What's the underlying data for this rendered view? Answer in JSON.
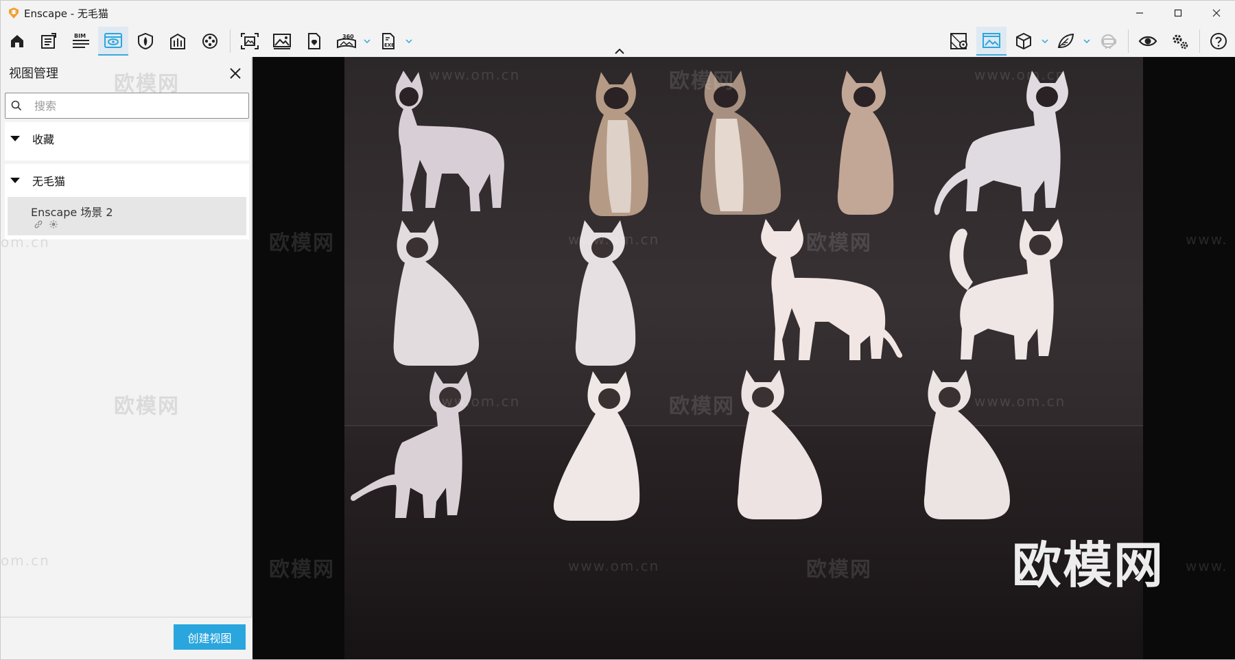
{
  "window": {
    "title": "Enscape - 无毛猫",
    "minimize_label": "minimize",
    "maximize_label": "maximize",
    "close_label": "close"
  },
  "toolbar": {
    "bim_label": "BIM",
    "pano_label": "360",
    "exe_label": "EXE",
    "accent_color": "#2aa6de"
  },
  "sidebar": {
    "title": "视图管理",
    "search": {
      "placeholder": "搜索",
      "value": ""
    },
    "favorites": {
      "label": "收藏"
    },
    "scene_group": {
      "label": "无毛猫",
      "items": [
        {
          "name": "Enscape 场景 2"
        }
      ]
    },
    "create_button": "创建视图"
  },
  "viewport": {
    "watermark_text": "欧模网",
    "watermark_url": "www.om.cn",
    "watermark_url_partial": "om.cn",
    "watermark_url_prefix": "www."
  }
}
